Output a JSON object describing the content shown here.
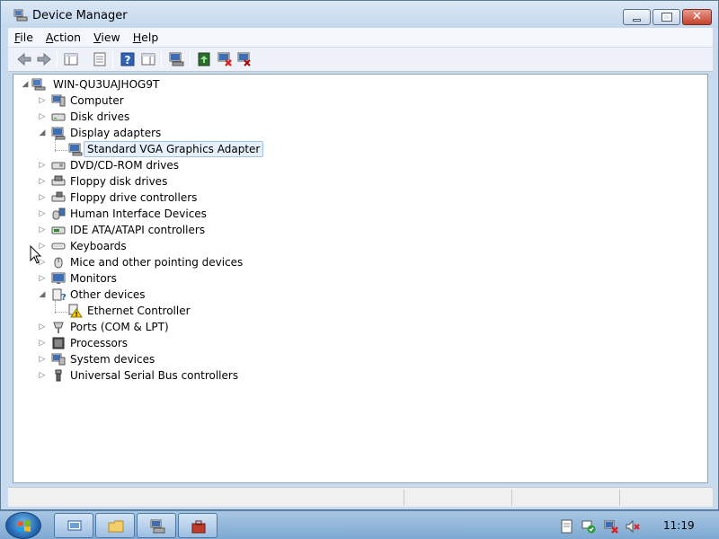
{
  "window": {
    "title": "Device Manager"
  },
  "menu": {
    "items": [
      {
        "label": "File",
        "mnemonic": "F",
        "rest": "ile"
      },
      {
        "label": "Action",
        "mnemonic": "A",
        "rest": "ction"
      },
      {
        "label": "View",
        "mnemonic": "V",
        "rest": "iew"
      },
      {
        "label": "Help",
        "mnemonic": "H",
        "rest": "elp"
      }
    ]
  },
  "toolbar": {
    "buttons": [
      "back-icon",
      "forward-icon",
      "show-hide-console-tree-icon",
      "properties-icon",
      "help-icon",
      "action-pane-icon",
      "scan-hardware-icon",
      "update-driver-icon",
      "disable-device-icon",
      "uninstall-device-icon"
    ]
  },
  "tree": {
    "root": "WIN-QU3UAJHOG9T",
    "nodes": [
      {
        "label": "Computer",
        "expanded": false,
        "icon": "computer-icon"
      },
      {
        "label": "Disk drives",
        "expanded": false,
        "icon": "disk-drive-icon"
      },
      {
        "label": "Display adapters",
        "expanded": true,
        "icon": "display-adapter-icon"
      },
      {
        "label": "Standard VGA Graphics Adapter",
        "child": true,
        "selected": true,
        "icon": "display-adapter-icon"
      },
      {
        "label": "DVD/CD-ROM drives",
        "expanded": false,
        "icon": "dvd-drive-icon"
      },
      {
        "label": "Floppy disk drives",
        "expanded": false,
        "icon": "floppy-disk-icon"
      },
      {
        "label": "Floppy drive controllers",
        "expanded": false,
        "icon": "floppy-controller-icon"
      },
      {
        "label": "Human Interface Devices",
        "expanded": false,
        "icon": "hid-icon"
      },
      {
        "label": "IDE ATA/ATAPI controllers",
        "expanded": false,
        "icon": "ide-controller-icon"
      },
      {
        "label": "Keyboards",
        "expanded": false,
        "icon": "keyboard-icon"
      },
      {
        "label": "Mice and other pointing devices",
        "expanded": false,
        "icon": "mouse-icon"
      },
      {
        "label": "Monitors",
        "expanded": false,
        "icon": "monitor-icon"
      },
      {
        "label": "Other devices",
        "expanded": true,
        "icon": "other-devices-icon"
      },
      {
        "label": "Ethernet Controller",
        "child": true,
        "warning": true,
        "icon": "warning-device-icon"
      },
      {
        "label": "Ports (COM & LPT)",
        "expanded": false,
        "icon": "ports-icon"
      },
      {
        "label": "Processors",
        "expanded": false,
        "icon": "processor-icon"
      },
      {
        "label": "System devices",
        "expanded": false,
        "icon": "system-devices-icon"
      },
      {
        "label": "Universal Serial Bus controllers",
        "expanded": false,
        "icon": "usb-icon"
      }
    ]
  },
  "taskbar": {
    "clock": "11:19",
    "tasks": [
      "server-manager-icon",
      "explorer-folder-icon",
      "device-manager-icon",
      "toolbox-icon"
    ],
    "tray": [
      "action-center-icon",
      "network-icon",
      "network-error-icon",
      "volume-muted-icon"
    ]
  },
  "colors": {
    "selection_bg": "#e6f0fa",
    "selection_border": "#9fc1e4",
    "taskbar": "#8fb3da",
    "close_button": "#c2412c"
  }
}
